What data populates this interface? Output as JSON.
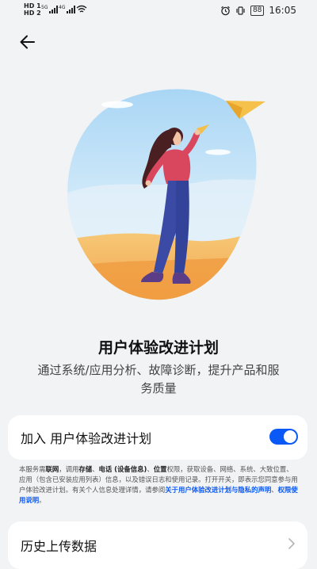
{
  "status_bar": {
    "sim1": "HD 1",
    "sim2": "HD 2",
    "net1": "5G",
    "net2": "4G",
    "battery": "88",
    "time": "16:05"
  },
  "icons": {
    "back": "arrow-left-icon",
    "wifi": "wifi-icon",
    "alarm": "alarm-icon",
    "vibrate": "vibrate-icon",
    "chevron": "chevron-right-icon"
  },
  "colors": {
    "accent": "#0a59f7",
    "background": "#f1f3f5",
    "card": "#ffffff"
  },
  "page": {
    "title": "用户体验改进计划",
    "description": "通过系统/应用分析、故障诊断，提升产品和服务质量"
  },
  "join_toggle": {
    "label": "加入 用户体验改进计划",
    "enabled": true
  },
  "notice": {
    "p1": "本服务需",
    "p2": "联网",
    "p3": "，调用",
    "p4": "存储",
    "p5": "、",
    "p6": "电话 (设备信息)",
    "p7": "、",
    "p8": "位置",
    "p9": "权限，获取设备、网络、系统、大致位置、应用（包含已安装应用列表）信息，以及错误日志和使用记录。打开开关，即表示您同意参与用户体验改进计划。有关个人信息处理详情，请参阅",
    "link1": "关于用户体验改进计划与隐私的声明",
    "p10": "、",
    "link2": "权限使用说明",
    "p11": "。"
  },
  "history": {
    "label": "历史上传数据"
  }
}
